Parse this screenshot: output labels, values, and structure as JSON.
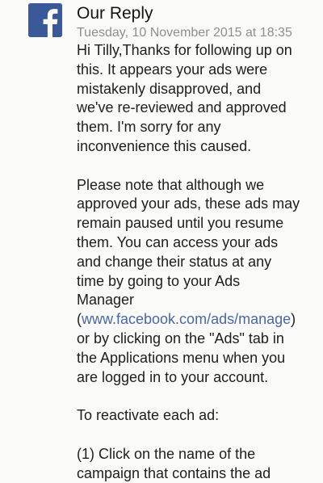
{
  "message_header": {
    "sender": "Our Reply",
    "timestamp": "Tuesday, 10 November 2015 at 18:35"
  },
  "avatar": {
    "icon": "facebook-logo-icon",
    "brand_color": "#3b5998"
  },
  "message": {
    "link_color": "#4a67a6",
    "paragraph1": [
      "Hi Tilly,Thanks for following up on",
      "this. It appears your ads were",
      "mistakenly disapproved, and",
      "we've re-reviewed and approved",
      "them. I'm sorry for any",
      "inconvenience this caused."
    ],
    "paragraph2": [
      "Please note that although we",
      "approved your ads, these ads may",
      "remain paused until you resume",
      "them. You can access your ads",
      "and change their status at any",
      "time by going to your Ads",
      "Manager"
    ],
    "link_prefix": "(",
    "link_text": "www.facebook.com/ads/manage",
    "link_suffix": ")",
    "paragraph2_end": [
      "or by clicking on the \"Ads\" tab in",
      "the Applications menu when you",
      "are logged in to your account."
    ],
    "paragraph3": [
      "To reactivate each ad:"
    ],
    "paragraph4": [
      "(1) Click on the name of the",
      "campaign that contains the ad"
    ]
  }
}
